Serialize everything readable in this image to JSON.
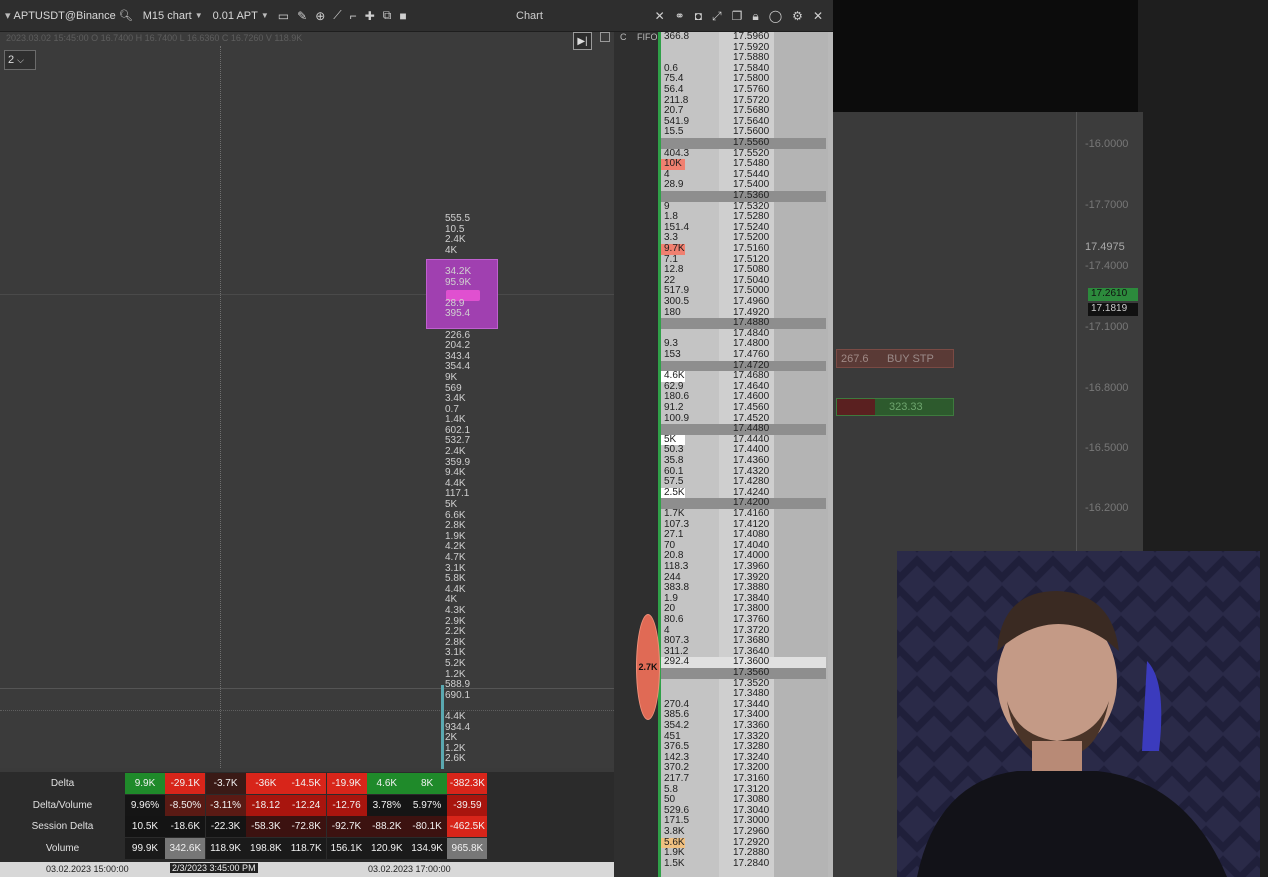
{
  "toolbar": {
    "instrument": "APTUSDT@Binance",
    "interval": "M15 chart",
    "quantity": "0.01 APT",
    "title": "Chart"
  },
  "info_line": "2023.03.02 15:45:00 O 16.7400 H 16.7400 L 16.6360 C 16.7260 V 118.9K",
  "scale_value": "2",
  "cluster_values": [
    "555.5",
    "10.5",
    "2.4K",
    "4K",
    "",
    "34.2K",
    "95.9K",
    "",
    "28.9",
    "395.4",
    "",
    "226.6",
    "204.2",
    "343.4",
    "354.4",
    "9K",
    "569",
    "3.4K",
    "0.7",
    "1.4K",
    "602.1",
    "532.7",
    "2.4K",
    "359.9",
    "9.4K",
    "4.4K",
    "117.1",
    "5K",
    "6.6K",
    "2.8K",
    "1.9K",
    "4.2K",
    "4.7K",
    "3.1K",
    "5.8K",
    "4.4K",
    "4K",
    "4.3K",
    "2.9K",
    "2.2K",
    "2.8K",
    "3.1K",
    "5.2K",
    "1.2K",
    "588.9",
    "690.1",
    "",
    "4.4K",
    "934.4",
    "2K",
    "1.2K",
    "2.6K"
  ],
  "stats": {
    "labels": [
      "Delta",
      "Delta/Volume",
      "Session Delta",
      "Volume"
    ],
    "delta": [
      "9.9K",
      "-29.1K",
      "-3.7K",
      "-36K",
      "-14.5K",
      "-19.9K",
      "4.6K",
      "8K",
      "-382.3K"
    ],
    "delta_volume": [
      "9.96%",
      "-8.50%",
      "-3.11%",
      "-18.12",
      "-12.24",
      "-12.76",
      "3.78%",
      "5.97%",
      "-39.59"
    ],
    "session_delta": [
      "10.5K",
      "-18.6K",
      "-22.3K",
      "-58.3K",
      "-72.8K",
      "-92.7K",
      "-88.2K",
      "-80.1K",
      "-462.5K"
    ],
    "volume": [
      "99.9K",
      "342.6K",
      "118.9K",
      "198.8K",
      "118.7K",
      "156.1K",
      "120.9K",
      "134.9K",
      "965.8K"
    ]
  },
  "time_axis": {
    "label_left": "03.02.2023 15:00:00",
    "cursor": "2/3/2023 3:45:00 PM",
    "label_right": "03.02.2023 17:00:00"
  },
  "dom": {
    "header_c": "C",
    "header_fifo": "FIFO",
    "bubble": "2.7K",
    "rows": [
      [
        "366.8",
        "17.5960"
      ],
      [
        "",
        "17.5920"
      ],
      [
        "",
        "17.5880"
      ],
      [
        "0.6",
        "17.5840"
      ],
      [
        "75.4",
        "17.5800"
      ],
      [
        "56.4",
        "17.5760"
      ],
      [
        "211.8",
        "17.5720"
      ],
      [
        "20.7",
        "17.5680"
      ],
      [
        "541.9",
        "17.5640"
      ],
      [
        "15.5",
        "17.5600"
      ],
      [
        "",
        "17.5560"
      ],
      [
        "404.3",
        "17.5520"
      ],
      [
        "10K",
        "17.5480"
      ],
      [
        "4",
        "17.5440"
      ],
      [
        "28.9",
        "17.5400"
      ],
      [
        "",
        "17.5360"
      ],
      [
        "9",
        "17.5320"
      ],
      [
        "1.8",
        "17.5280"
      ],
      [
        "151.4",
        "17.5240"
      ],
      [
        "3.3",
        "17.5200"
      ],
      [
        "9.7K",
        "17.5160"
      ],
      [
        "7.1",
        "17.5120"
      ],
      [
        "12.8",
        "17.5080"
      ],
      [
        "22",
        "17.5040"
      ],
      [
        "517.9",
        "17.5000"
      ],
      [
        "300.5",
        "17.4960"
      ],
      [
        "180",
        "17.4920"
      ],
      [
        "",
        "17.4880"
      ],
      [
        "",
        "17.4840"
      ],
      [
        "9.3",
        "17.4800"
      ],
      [
        "153",
        "17.4760"
      ],
      [
        "",
        "17.4720"
      ],
      [
        "4.6K",
        "17.4680"
      ],
      [
        "62.9",
        "17.4640"
      ],
      [
        "180.6",
        "17.4600"
      ],
      [
        "91.2",
        "17.4560"
      ],
      [
        "100.9",
        "17.4520"
      ],
      [
        "",
        "17.4480"
      ],
      [
        "5K",
        "17.4440"
      ],
      [
        "50.3",
        "17.4400"
      ],
      [
        "35.8",
        "17.4360"
      ],
      [
        "60.1",
        "17.4320"
      ],
      [
        "57.5",
        "17.4280"
      ],
      [
        "2.5K",
        "17.4240"
      ],
      [
        "",
        "17.4200"
      ],
      [
        "1.7K",
        "17.4160"
      ],
      [
        "107.3",
        "17.4120"
      ],
      [
        "27.1",
        "17.4080"
      ],
      [
        "70",
        "17.4040"
      ],
      [
        "20.8",
        "17.4000"
      ],
      [
        "118.3",
        "17.3960"
      ],
      [
        "244",
        "17.3920"
      ],
      [
        "383.8",
        "17.3880"
      ],
      [
        "1.9",
        "17.3840"
      ],
      [
        "20",
        "17.3800"
      ],
      [
        "80.6",
        "17.3760"
      ],
      [
        "4",
        "17.3720"
      ],
      [
        "807.3",
        "17.3680"
      ],
      [
        "311.2",
        "17.3640"
      ],
      [
        "292.4",
        "17.3600"
      ],
      [
        "",
        "17.3560"
      ],
      [
        "",
        "17.3520"
      ],
      [
        "",
        "17.3480"
      ],
      [
        "270.4",
        "17.3440"
      ],
      [
        "385.6",
        "17.3400"
      ],
      [
        "354.2",
        "17.3360"
      ],
      [
        "451",
        "17.3320"
      ],
      [
        "376.5",
        "17.3280"
      ],
      [
        "142.3",
        "17.3240"
      ],
      [
        "370.2",
        "17.3200"
      ],
      [
        "217.7",
        "17.3160"
      ],
      [
        "5.8",
        "17.3120"
      ],
      [
        "50",
        "17.3080"
      ],
      [
        "529.6",
        "17.3040"
      ],
      [
        "171.5",
        "17.3000"
      ],
      [
        "3.8K",
        "17.2960"
      ],
      [
        "5.6K",
        "17.2920"
      ],
      [
        "1.9K",
        "17.2880"
      ],
      [
        "1.5K",
        "17.2840"
      ]
    ]
  },
  "bg_chart": {
    "axis_labels": [
      "-16.0000",
      "-17.7000",
      "17.4975",
      "-17.4000",
      "-17.1000",
      "-16.8000",
      "-16.5000",
      "-16.2000"
    ],
    "order1_qty": "267.6",
    "order1_label": "BUY STP",
    "order2_value": "323.33",
    "price_tag_1": "17.2610",
    "price_tag_2": "17.1819"
  },
  "colors": {
    "positive": "#1f8a2a",
    "negative": "#d8251a",
    "poc": "#a040b0",
    "dom_highlight": "#f08070"
  }
}
